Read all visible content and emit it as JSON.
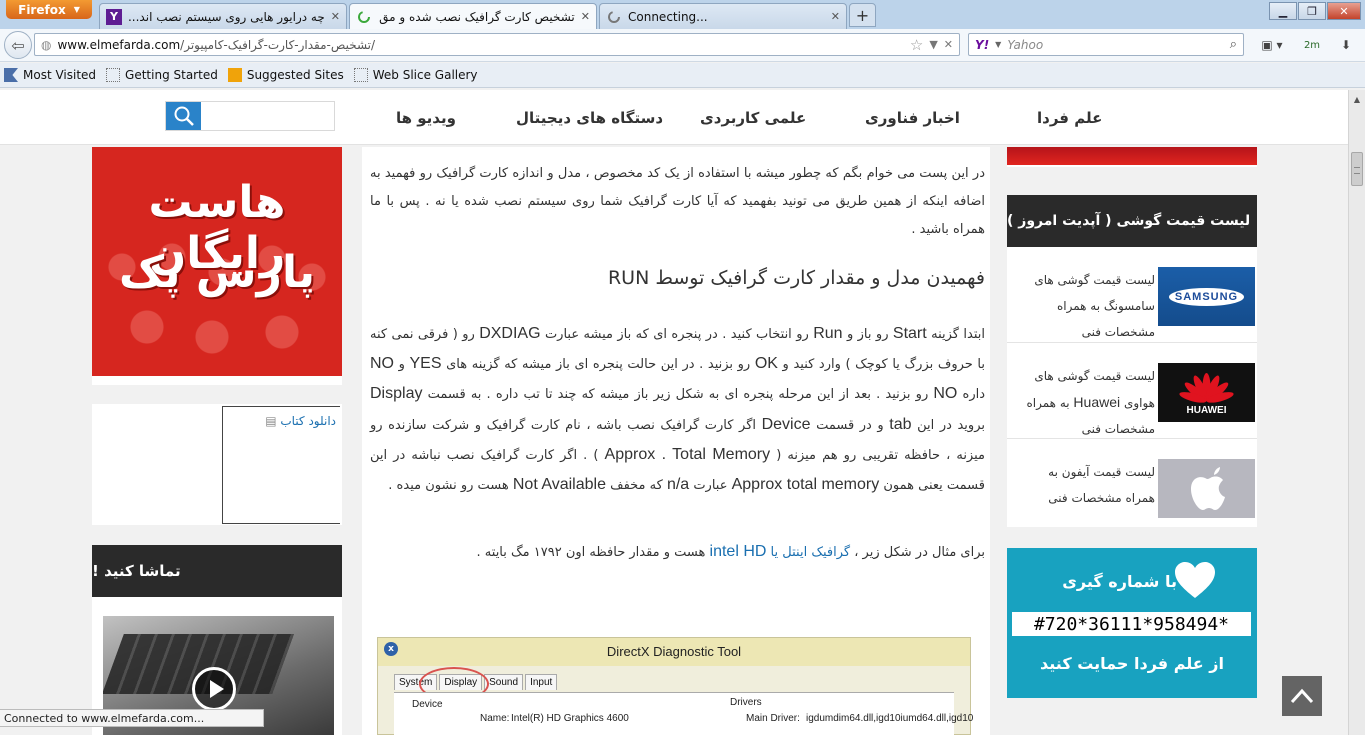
{
  "browser": {
    "app_button": "Firefox",
    "tabs": [
      {
        "title": "چه درایور هایی روی سیستم نصب اند...",
        "icon": "yahoo-icon"
      },
      {
        "title": "تشخیص کارت گرافیک نصب شده و مق...",
        "icon": "loading-icon"
      },
      {
        "title": "Connecting...",
        "icon": "loading-icon"
      }
    ],
    "new_tab": "+",
    "url_domain": "www.elmefarda.com",
    "url_path": "/تشخیص-مقدار-کارت-گرافیک-کامپیوتر/",
    "search_placeholder": "Yahoo",
    "search_engine": "Y!",
    "addon_label": "2m",
    "bookmarks": [
      "Most Visited",
      "Getting Started",
      "Suggested Sites",
      "Web Slice Gallery"
    ],
    "status": "Connected to www.elmefarda.com..."
  },
  "site": {
    "nav": [
      "علم فردا",
      "اخبار فناوری",
      "علمی کاربردی",
      "دستگاه های دیجیتال",
      "ویدیو ها"
    ],
    "search_placeholder": ""
  },
  "left": {
    "ad_line1": "هاست رایگان",
    "ad_line2": "پارس پک",
    "book_link": "دانلود کتاب",
    "watch_title": "تماشا کنید !"
  },
  "article": {
    "p1": "در این پست می خوام بگم که چطور میشه با استفاده از یک کد مخصوص ، مدل و اندازه کارت گرافیک رو فهمید به اضافه اینکه از همین طریق می تونید بفهمید که آیا کارت گرافیک شما روی سیستم نصب شده یا نه . پس با ما همراه باشید .",
    "heading": "فهمیدن مدل و مقدار کارت گرافیک توسط RUN",
    "p2_a": "ابتدا گزینه ",
    "p2_start": "Start",
    "p2_b": " رو باز و ",
    "p2_run": "Run",
    "p2_c": " رو انتخاب کنید . در پنجره ای که باز میشه عبارت ",
    "p2_dxdiag": "DXDIAG",
    "p2_d": " رو ( فرقی نمی کنه با حروف بزرگ یا کوچک ) وارد کنید و ",
    "p2_ok": "OK",
    "p2_e": " رو بزنید . در این حالت پنجره ای باز میشه که گزینه های ",
    "p2_yes": "YES",
    "p2_f": " و ",
    "p2_no": "NO",
    "p2_g": " داره ",
    "p2_no2": "NO",
    "p2_h": " رو بزنید . بعد از این مرحله پنجره ای به شکل زیر باز میشه که چند تا تب داره . به قسمت ",
    "p2_display": "Display",
    "p2_i": " برويد در این ",
    "p2_tab": "tab",
    "p2_j": " و در قسمت ",
    "p2_device": "Device",
    "p2_k": " اگر کارت گرافیک نصب باشه ، نام کارت گرافیک و شرکت سازنده رو میزنه ، حافظه تقریبی رو هم میزنه ( ",
    "p2_approx": "Approx . Total Memory",
    "p2_l": " ) . اگر کارت گرافیک نصب نباشه در این قسمت یعنی همون ",
    "p2_approx2": "Approx total memory",
    "p2_m": " عبارت ",
    "p2_na": "n/a",
    "p2_n": " که مخفف ",
    "p2_notavail": "Not Available",
    "p2_o": " هست رو نشون میده .",
    "p3_a": "برای مثال در شکل زیر ، ",
    "p3_link": "گرافیک اینتل یا ",
    "p3_intel": "intel HD",
    "p3_b": " هست و مقدار حافظه اون ۱۷۹۲ مگ بایته ."
  },
  "dxdiag": {
    "title": "DirectX Diagnostic Tool",
    "tabs": [
      "System",
      "Display",
      "Sound",
      "Input"
    ],
    "device_label": "Device",
    "drivers_label": "Drivers",
    "name_label": "Name:",
    "name_value": "Intel(R) HD Graphics 4600",
    "main_driver_label": "Main Driver:",
    "main_driver_value": "igdumdim64.dll,igd10iumd64.dll,igd10"
  },
  "right": {
    "price_title": "لیست قیمت گوشی ( آپدیت امروز )",
    "items": [
      {
        "text_a": "لیست قیمت گوشی های سامسونگ به همراه مشخصات فنی",
        "thumb": "SAMSUNG"
      },
      {
        "text_a": "لیست قیمت گوشی های هواوی ",
        "en": "Huawei",
        "text_b": " به همراه مشخصات فنی",
        "thumb": "HUAWEI"
      },
      {
        "text_a": "لیست قیمت آیفون به همراه مشخصات فنی",
        "thumb": "apple-logo-icon"
      }
    ],
    "donate_line1": "با شماره گیری",
    "donate_code": "#720*36111*958494*",
    "donate_line3": "از علم فردا حمایت کنید"
  },
  "colors": {
    "accent_blue": "#2a83c9",
    "ad_red": "#d6261f",
    "donate_teal": "#18a2c0",
    "dark_header": "#2a2a2a",
    "link": "#1a6fb0"
  }
}
